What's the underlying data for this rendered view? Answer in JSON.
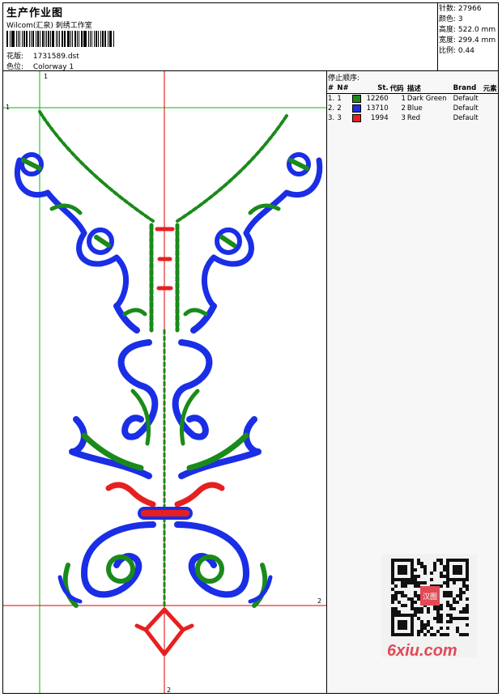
{
  "header": {
    "title": "生产作业图",
    "subtitle": "Wilcom(汇泉) 刺绣工作室",
    "design_label": "花版:",
    "design_value": "1731589.dst",
    "colorway_label": "色位:",
    "colorway_value": "Colorway 1"
  },
  "stats": [
    {
      "label": "针数:",
      "value": "27966"
    },
    {
      "label": "颜色:",
      "value": "3"
    },
    {
      "label": "高度:",
      "value": "522.0 mm"
    },
    {
      "label": "宽度:",
      "value": "299.4 mm"
    },
    {
      "label": "比例:",
      "value": "0.44"
    }
  ],
  "stop_sequence": {
    "title": "停止顺序:",
    "columns": [
      "#",
      "N#",
      "St.",
      "代码",
      "描述",
      "Brand",
      "元素"
    ],
    "rows": [
      {
        "idx": "1.",
        "n": "1",
        "color": "#1a8a1a",
        "st": "12260",
        "code": "1",
        "desc": "Dark Green",
        "brand": "Default",
        "elem": ""
      },
      {
        "idx": "2.",
        "n": "2",
        "color": "#1a2ee6",
        "st": "13710",
        "code": "2",
        "desc": "Blue",
        "brand": "Default",
        "elem": ""
      },
      {
        "idx": "3.",
        "n": "3",
        "color": "#e62020",
        "st": "1994",
        "code": "3",
        "desc": "Red",
        "brand": "Default",
        "elem": ""
      }
    ]
  },
  "guides": {
    "top_label": "1",
    "left_label": "1",
    "right_label": "2",
    "bottom_label": "2"
  },
  "watermark": {
    "logo": "6xiu.com",
    "stamp": "汉图"
  },
  "colors": {
    "green": "#1a8a1a",
    "blue": "#1a2ee6",
    "red": "#e62020",
    "guide_green": "#00c000",
    "guide_red": "#e00000"
  }
}
